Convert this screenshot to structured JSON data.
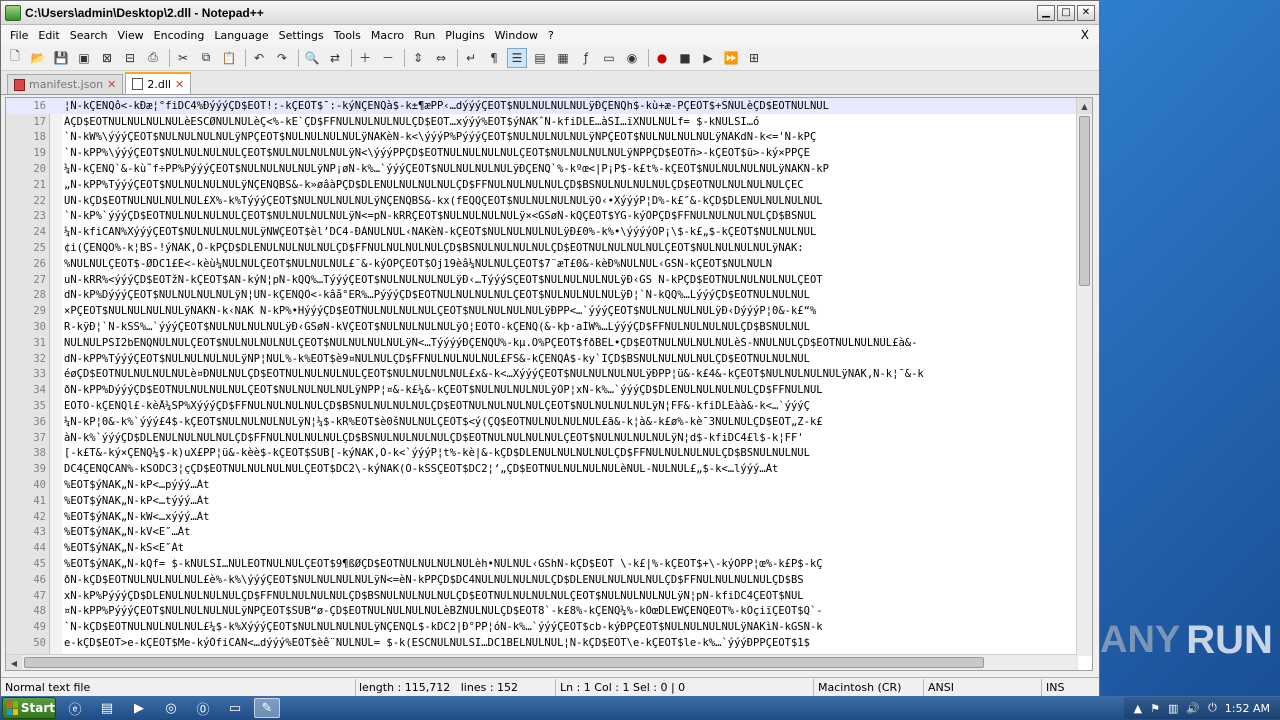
{
  "window": {
    "title": "C:\\Users\\admin\\Desktop\\2.dll - Notepad++"
  },
  "menu": {
    "items": [
      "File",
      "Edit",
      "Search",
      "View",
      "Encoding",
      "Language",
      "Settings",
      "Tools",
      "Macro",
      "Run",
      "Plugins",
      "Window",
      "?"
    ],
    "close_label": "X"
  },
  "tabs": [
    {
      "label": "manifest.json",
      "active": false
    },
    {
      "label": "2.dll",
      "active": true
    }
  ],
  "editor": {
    "lines": [
      {
        "n": "16",
        "text": "¦Ñ-kÇENQô<-kÐæ¦°fiDC4%ÐýýýÇD$EOT!:-kÇEOT$¯:-kýÑÇENQà$-k±¶æPP‹…dýýýÇEOT$NULNULNULNULÿÐÇENQh$-kù+æ-PÇEOT$+SNULèÇD$EOTNULNUL"
      },
      {
        "n": "17",
        "text": "ÀÇD$EOTNULNULNULNULèESCØNULNULèÇ<%-kE`ÇD$FFNULNULNULNULÇD$EOT…xýýý%EOT$ýNAKˆÑ-kfiDLE…àSI…ïXNULNULf= $-kNULSI…ó"
      },
      {
        "n": "18",
        "text": "`Ñ-kW%\\ýýýÇEOT$NULNULNULNULÿÑPÇEOT$NULNULNULNULÿNAKèÑ-k<\\ýýýP%PýýýÇEOT$NULNULNULNULÿÑPÇEOT$NULNULNULNULÿNAKdÑ-k<='Ñ-kPÇ"
      },
      {
        "n": "19",
        "text": "`Ñ-kPP%\\ýýýÇEOT$NULNULNULNULÇEOT$NULNULNULNULÿÑ<\\ýýýPPÇD$EOTNULNULNULNULÇEOT$NULNULNULNULÿÑPPÇD$EOTñ>-kÇEOT$ü>-ký×PPÇE"
      },
      {
        "n": "20",
        "text": "¼Ñ-kÇENQ`&-kù˜f÷PP%PýýýÇEOT$NULNULNULNULÿÑP¡øÑ-k%…`ýýýÇEOT$NULNULNULNULÿÐÇENQ`%-kºœ<|P¡P$-k£t%-kÇEOT$NULNULNULNULÿNAKÑ-kP"
      },
      {
        "n": "21",
        "text": "„Ñ-kPP%TýýýÇEOT$NULNULNULNULÿÑÇENQBS&-k»øâàPÇD$DLENULNULNULNULÇD$FFNULNULNULNULÇD$BSNULNULNULNULÇD$EOTNULNULNULNULÇEC"
      },
      {
        "n": "22",
        "text": "ÜÑ-kÇD$EOTNULNULNULNUL£X%-k%TýýýÇEOT$NULNULNULNULÿÑÇENQBS&-kx(fEQQÇEOT$NULNULNULNULÿÓ‹•XýýýP¦D%-k£″&-kÇD$DLENULNULNULNUL"
      },
      {
        "n": "23",
        "text": "`Ñ-kP%`ýýýÇD$EOTNULNULNULNULÇEOT$NULNULNULNULÿÑ<=pÑ-kRRÇEOT$NULNULNULNULÿ×<GSøÑ-kQÇEOT$YG-kýÓPÇD$FFNULNULNULNULÇD$BSNUL"
      },
      {
        "n": "24",
        "text": "¼Ñ-kfiCAN%XýýýÇEOT$NULNULNULNULÿÑWÇEOT$èl’DC4-ÐÀNULNUL‹NAKèÑ-kÇEOT$NULNULNULNULÿÐ£0%-k%•\\ýýýýÓP¡\\$-k£„$-kÇEOT$NULNULNUL"
      },
      {
        "n": "25",
        "text": "¢i(ÇENQÔ%-k¦BS-!ýNAK,Ô-kPÇD$DLENULNULNULNULÇD$FFNULNULNULNULÇD$BSNULNULNULNULÇD$EOTNULNULNULNULÇEOT$NULNULNULNULÿNAK:"
      },
      {
        "n": "26",
        "text": "%NULNULÇEOT$-ØDC1£È<-kèù¼NULNULÇEOT$NULNULNUL£¯&-kýÓPÇEOT$Ój19èâ¼NULNULÇEOT$7¨æT£0&-kèÐ%NULNUL‹GSÑ-kÇEOT$NULNULN"
      },
      {
        "n": "27",
        "text": "uÑ-kRR%<ýýýÇD$EOTžN-kÇEOT$ÃN-kýÑ¦pÑ-kQQ%…TýýýÇEOT$NULNULNULNULÿÐ‹…TýýýSÇEOT$NULNULNULNULÿÐ‹GS Ñ-kPÇD$EOTNULNULNULNULÇEOT"
      },
      {
        "n": "28",
        "text": "dÑ-kP%DýýýÇEOT$NULNULNULNULÿÑ¦ÜÑ-kÇENQÔ<-kâå°ER%…PýýýÇD$EOTNULNULNULNULÇEOT$NULNULNULNULÿÐ¦`Ñ-kQQ%…LýýýÇD$EOTNULNULNUL"
      },
      {
        "n": "29",
        "text": "×PÇEOT$NULNULNULNULÿNAKÑ-k‹NAK Ñ-kP%•HýýýÇD$EOTNULNULNULNULÇEOT$NULNULNULNULÿÐPP<…`ýýýÇEOT$NULNULNULNULÿÐ‹DýýýP¦0&-k£“%"
      },
      {
        "n": "30",
        "text": "R-kÿÐ¦`Ñ-kSS%…`ýýýÇEOT$NULNULNULNULÿÐ‹GSøÑ-kVÇEOT$NULNULNULNULÿÓ¦EOTÒ-kÇENQ(&-kþ·aÍW%…LýýýÇD$FFNULNULNULNULÇD$BSNULNUL"
      },
      {
        "n": "31",
        "text": "NULNULPSI2bENQNULNULÇEOT$NULNULNULNULÇEOT$NULNULNULNULÿÑ<…TýýýýÐÇENQÛ%-kµ.Ö%PÇEOT$fðBEL•ÇD$EOTNULNULNULNULèŠ-ÑNULNULÇD$EOTNULNULNUL£à&-"
      },
      {
        "n": "32",
        "text": "dÑ-kPP%TýýýÇEOT$NULNULNULNULÿÑP¦NUL%-k%EOT$è9¤NULNULÇD$FFNULNULNULNUL£FS&-kÇENQÀ$-ky`ÏÇD$BSNULNULNULNULÇD$EOTNULNULNUL"
      },
      {
        "n": "33",
        "text": "éøÇD$EOTNULNULNULNULè¤ÐNULNULÇD$EOTNULNULNULNULÇEOT$NULNULNULNUL£x&-k<…XýýýÇEOT$NULNULNULNULÿÐPP¦ü&-k£4&-kÇEOT$NULNULNULNULÿNAK,Ñ-k¦¯&-k"
      },
      {
        "n": "34",
        "text": "ðÑ-kPP%DýýýÇD$EOTNULNULNULNULÇEOT$NULNULNULNULÿÑPP¦¤&-k£¼&-kÇEOT$NULNULNULNULÿÓP¦xÑ-k%…`ýýýÇD$DLENULNULNULNULÇD$FFNULNUL"
      },
      {
        "n": "35",
        "text": "EOTÒ-kÇENQl£-kèÅ¼SP%XýýýÇD$FFNULNULNULNULÇD$BSNULNULNULNULÇD$EOTNULNULNULNULÇEOT$NULNULNULNULÿÑ¦FF&-kfiDLEàà&-k<…`ýýýÇ"
      },
      {
        "n": "36",
        "text": "¼Ñ-kP¦0&-k%`ýýý£4$-kÇEOT$NULNULNULNULÿÑ¦¼$-kR%EOT$è0šNULNULÇEOT$<ý(ÇQ$EOTNULNULNULNUL£ã&-k¦à&-k£ø%-kè¯3NULNULÇD$EOT„Z-k£"
      },
      {
        "n": "37",
        "text": "àÑ-k%`ýýýÇD$DLENULNULNULNULÇD$FFNULNULNULNULÇD$BSNULNULNULNULÇD$EOTNULNULNULNULÇEOT$NULNULNULNULÿÑ¦d$-kfiDC4£l$-k¦FF'"
      },
      {
        "n": "38",
        "text": "[-k£T&-ký×ÇENQ¼$-k)uX£PP¦ü&-kèè$-kÇEOT$SUB[-kýNAK,Ò-k<`ýýýP¦t%-kè|&-kÇD$DLENULNULNULNULÇD$FFNULNULNULNULÇD$BSNULNULNUL"
      },
      {
        "n": "39",
        "text": "DC4ÇENQCAN%-kSODC3¦çÇD$EOTNULNULNULNULÇEOT$DC2\\-kýNAK(Ò-kSSÇEOT$DC2¦‘„ÇD$EOTNULNULNULNULèNUL-NULNUL£„$-k<…lýýý…Àt"
      },
      {
        "n": "40",
        "text": "%EOT$ýNAK„Ñ-kP<…pýýý…Àt"
      },
      {
        "n": "41",
        "text": "%EOT$ýNAK„Ñ-kP<…týýý…Àt"
      },
      {
        "n": "42",
        "text": "%EOT$ýNAK„Ñ-kW<…xýýý…Àt"
      },
      {
        "n": "43",
        "text": "%EOT$ýNAK„Ñ-kV<E″…Àt"
      },
      {
        "n": "44",
        "text": "%EOT$ýNAK„Ñ-kS<E″Àt"
      },
      {
        "n": "45",
        "text": "%EOT$ýNAK„Ñ-kQf= $-kNULSI…NULEOTNULNULÇEOT$9¶ßØÇD$EOTNULNULNULNULèh•NULNUL‹GShÑ-kÇD$EOT \\-k£|%-kÇEOT$+\\-kýÓPP¦œ%-k£P$-kÇ"
      },
      {
        "n": "46",
        "text": "ðÑ-kÇD$EOTNULNULNULNUL£è%-k%\\ýýýÇEOT$NULNULNULNULÿÑ<=èÑ-kPPÇD$DC4NULNULNULNULÇD$DLENULNULNULNULÇD$FFNULNULNULNULÇD$BS"
      },
      {
        "n": "47",
        "text": "xÑ-kP%PýýýÇD$DLENULNULNULNULÇD$FFNULNULNULNULÇD$BSNULNULNULNULÇD$EOTNULNULNULNULÇEOT$NULNULNULNULÿÑ¦pÑ-kfiDC4ÇEOT$NUL"
      },
      {
        "n": "48",
        "text": "¤Ñ-kPP%PýýýÇEOT$NULNULNULNULÿÑPÇEOT$SUB“ø-ÇD$EOTNULNULNULNULèBŽNULNULÇD$EOT8`-k£8%-kÇENQ¼%-kÕœDLEWÇENQEOT%-kÓçiïÇEOT$Q`-"
      },
      {
        "n": "49",
        "text": "`Ñ-kÇD$EOTNULNULNULNUL£¼$-k%XýýýÇEOT$NULNULNULNULÿÑÇENQL$-kDC2|Ð°PP¦óÑ-k%…`ýýýÇEOT$cb-kýÐPÇEOT$NULNULNULNULÿNAKìÑ-kGSÑ-k"
      },
      {
        "n": "50",
        "text": "e-kÇD$EOT>e-kÇEOT$Me-kýÓfiCAN<…dýýý%EOT$èê¨NULNUL= $-k(ESCNULNULSI…DC1BELNULNUL¦Ñ-kÇD$EOT\\e-kÇEOT$le-k%…`ýýýÐPPÇEOT$1$"
      }
    ]
  },
  "status": {
    "filetype": "Normal text file",
    "length": "length : 115,712",
    "lines": "lines : 152",
    "position": "Ln : 1    Col : 1    Sel : 0 | 0",
    "eol": "Macintosh (CR)",
    "encoding": "ANSI",
    "mode": "INS"
  },
  "taskbar": {
    "start_label": "Start",
    "time": "1:52 AM"
  },
  "watermark": {
    "text_a": "ANY",
    "text_b": "RUN"
  }
}
